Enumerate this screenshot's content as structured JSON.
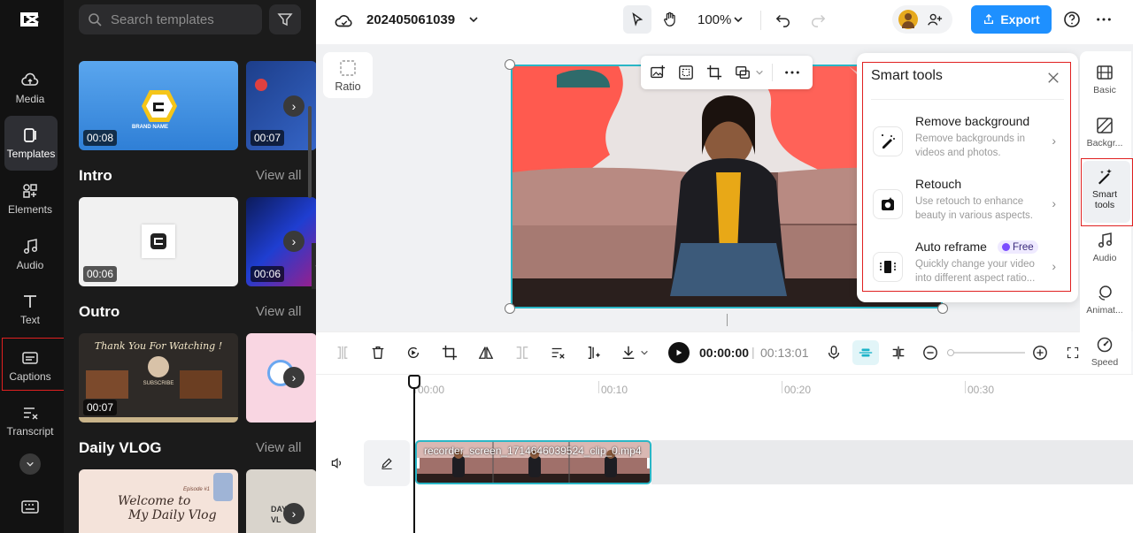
{
  "sidebar": {
    "items": [
      {
        "label": "Media"
      },
      {
        "label": "Templates"
      },
      {
        "label": "Elements"
      },
      {
        "label": "Audio"
      },
      {
        "label": "Text"
      },
      {
        "label": "Captions"
      },
      {
        "label": "Transcript"
      }
    ]
  },
  "panel": {
    "search_placeholder": "Search templates",
    "view_all": "View all",
    "sections": [
      {
        "title": "Intro",
        "durations": [
          "00:06",
          "00:06"
        ]
      },
      {
        "title": "Outro",
        "durations": [
          "00:07"
        ]
      },
      {
        "title": "Daily VLOG",
        "durations": []
      }
    ],
    "top_durations": [
      "00:08",
      "00:07"
    ],
    "thumb_texts": {
      "brand": "BRAND NAME",
      "thanks": "Thank You For Watching !",
      "subscribe": "SUBSCRIBE",
      "vlog_title_1": "Welcome to",
      "vlog_title_2": "My Daily Vlog",
      "episode": "Episode #1",
      "day": "DAY",
      "vl": "VL"
    }
  },
  "topbar": {
    "project_name": "202405061039",
    "zoom": "100%",
    "export_label": "Export"
  },
  "canvas": {
    "ratio_label": "Ratio"
  },
  "smart_tools": {
    "title": "Smart tools",
    "tools": [
      {
        "title": "Remove background",
        "desc": "Remove backgrounds in videos and photos."
      },
      {
        "title": "Retouch",
        "desc": "Use retouch to enhance beauty in various aspects."
      },
      {
        "title": "Auto reframe",
        "badge": "Free",
        "desc": "Quickly change your video into different aspect ratio..."
      }
    ]
  },
  "rightbar": {
    "items": [
      {
        "label": "Basic"
      },
      {
        "label": "Backgr..."
      },
      {
        "label": "Smart tools"
      },
      {
        "label": "Audio"
      },
      {
        "label": "Animat..."
      },
      {
        "label": "Speed"
      }
    ]
  },
  "playback": {
    "current": "00:00:00",
    "separator": "|",
    "total": "00:13:01"
  },
  "timeline": {
    "ticks": [
      "00:00",
      "00:10",
      "00:20",
      "00:30"
    ],
    "clip_name": "recorder_screen_1714646039524_clip_0.mp4"
  },
  "colors": {
    "accent": "#00bcd4",
    "export": "#1e90ff",
    "highlight": "#e02020",
    "free_badge": "#7b4dff"
  }
}
